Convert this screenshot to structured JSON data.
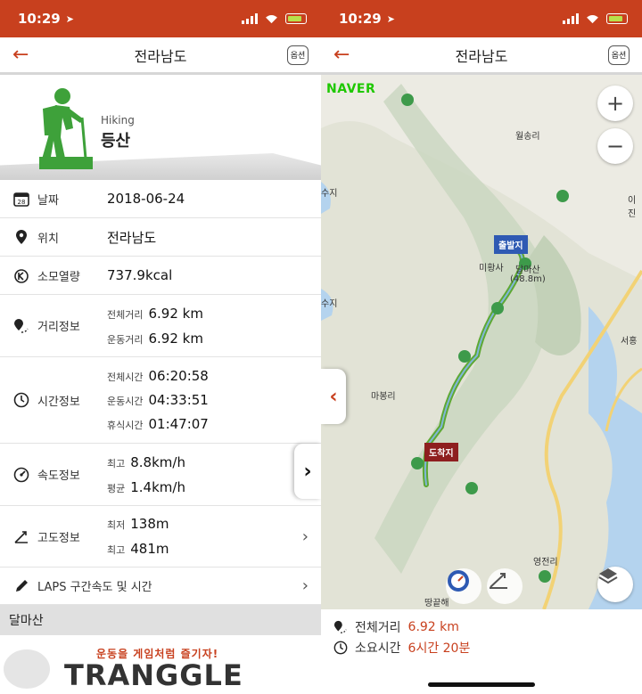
{
  "status": {
    "time": "10:29"
  },
  "left": {
    "nav": {
      "title": "전라남도",
      "option_label": "옵션"
    },
    "hero": {
      "subtitle": "Hiking",
      "title": "등산"
    },
    "rows": {
      "date": {
        "label": "날짜",
        "value": "2018-06-24",
        "icon_text": "28"
      },
      "location": {
        "label": "위치",
        "value": "전라남도"
      },
      "calories": {
        "label": "소모열량",
        "value": "737.9kcal"
      },
      "distance": {
        "label": "거리정보",
        "total_k": "전체거리",
        "total_v": "6.92 km",
        "moving_k": "운동거리",
        "moving_v": "6.92 km"
      },
      "time": {
        "label": "시간정보",
        "total_k": "전체시간",
        "total_v": "06:20:58",
        "moving_k": "운동시간",
        "moving_v": "04:33:51",
        "rest_k": "휴식시간",
        "rest_v": "01:47:07"
      },
      "speed": {
        "label": "속도정보",
        "max_k": "최고",
        "max_v": "8.8km/h",
        "avg_k": "평균",
        "avg_v": "1.4km/h"
      },
      "altitude": {
        "label": "고도정보",
        "min_k": "최저",
        "min_v": "138m",
        "max_k": "최고",
        "max_v": "481m"
      },
      "laps": {
        "label": "LAPS 구간속도 및 시간"
      }
    },
    "section_title": "달마산",
    "banner": {
      "slogan": "운동을 게임처럼 즐기자!",
      "logo": "TRANGGLE"
    }
  },
  "right": {
    "nav": {
      "title": "전라남도",
      "option_label": "옵션"
    },
    "map": {
      "provider": "NAVER",
      "zoom_in": "+",
      "zoom_out": "−",
      "places": {
        "wolsong": "월송리",
        "ijin": "이진",
        "suji1": "수지",
        "suji2": "수지",
        "mihwangsa": "미황사",
        "dalmasan": "달마산",
        "dalmasan_height": "(48.8m)",
        "seohong": "서홍",
        "mabong": "마봉리",
        "yeongjeon": "영전리",
        "ttanggeut": "땅끝해"
      },
      "start_tag": "출발지",
      "end_tag": "도착지"
    },
    "summary": {
      "distance_k": "전체거리",
      "distance_v": "6.92 km",
      "duration_k": "소요시간",
      "duration_v": "6시간 20분"
    }
  }
}
